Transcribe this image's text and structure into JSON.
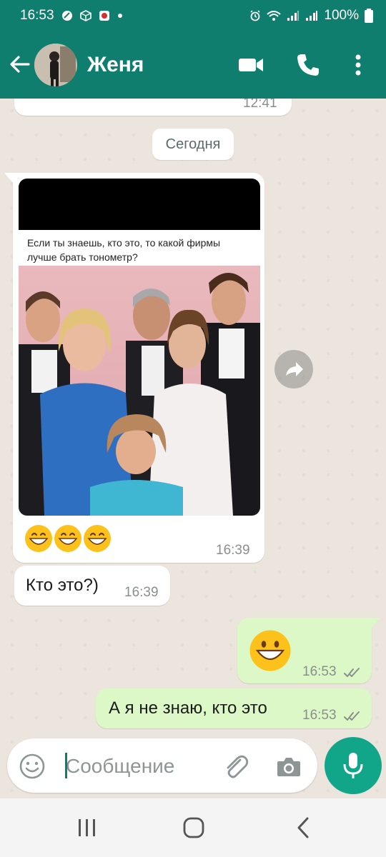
{
  "status_bar": {
    "time": "16:53",
    "battery": "100%"
  },
  "header": {
    "contact_name": "Женя",
    "icons": [
      "back-arrow-icon",
      "avatar",
      "video-call-icon",
      "phone-icon",
      "more-vert-icon"
    ]
  },
  "colors": {
    "header": "#0f7e6e",
    "incoming_bubble": "#ffffff",
    "outgoing_bubble": "#dcf8c6",
    "mic_button": "#11a68a",
    "chat_bg": "#ece5dd"
  },
  "messages": {
    "prev_time": "12:41",
    "date_chip": "Сегодня",
    "image_caption": "Если ты знаешь, кто это, то какой фирмы лучше брать тонометр?",
    "image_msg_time": "16:39",
    "text_msg_1": "Кто это?)",
    "text_msg_1_time": "16:39",
    "out_emoji_time": "16:53",
    "out_text": "А я не знаю,  кто это",
    "out_text_time": "16:53"
  },
  "input": {
    "placeholder": "Сообщение"
  }
}
